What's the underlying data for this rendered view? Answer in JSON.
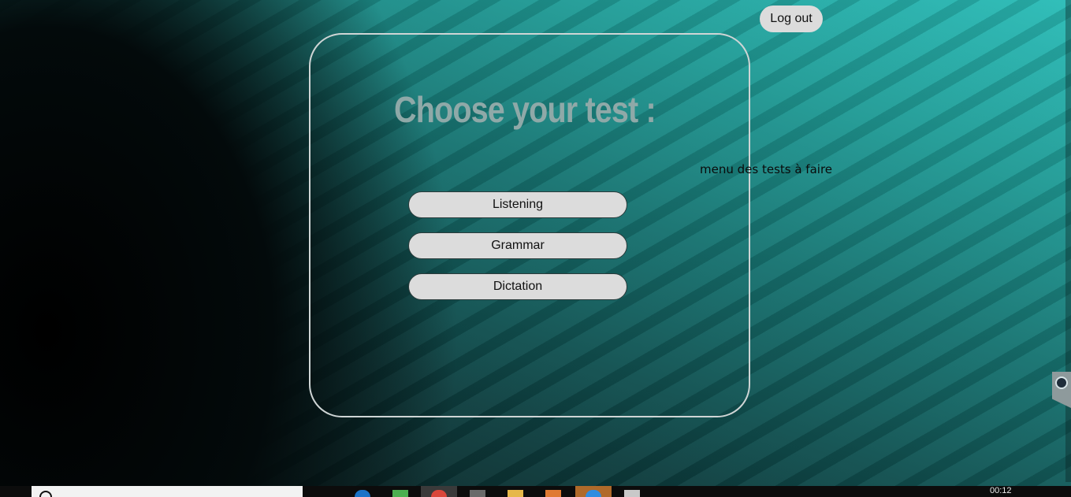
{
  "header": {
    "logout_label": "Log out"
  },
  "main": {
    "title": "Choose your test :",
    "caption": "menu des tests à faire",
    "tests": [
      {
        "label": "Listening"
      },
      {
        "label": "Grammar"
      },
      {
        "label": "Dictation"
      }
    ]
  },
  "taskbar": {
    "clock": "00:12",
    "icons": [
      "search-icon",
      "edge-icon",
      "sticky-icon",
      "chrome-icon",
      "app-icon",
      "folder-icon",
      "store-icon",
      "teamviewer-icon",
      "file-icon"
    ]
  },
  "colors": {
    "button_bg": "#dcdcdc",
    "title_color": "#8fa9a8",
    "panel_border": "#cfd5d5",
    "background_accent": "#2bbdb8"
  }
}
